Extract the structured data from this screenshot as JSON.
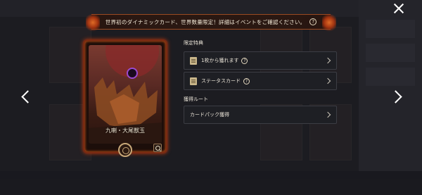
{
  "banner": {
    "text": "世界初のダイナミックカード、世界数量限定！詳細はイベントをご確認ください。",
    "help": "?"
  },
  "card": {
    "name": "九喇・大尾獣玉"
  },
  "limited_bonus": {
    "heading": "限定特典",
    "items": [
      {
        "label": "1枚から獲れます",
        "help": "?",
        "icon": "scroll-icon"
      },
      {
        "label": "ステータスカード",
        "help": "?",
        "icon": "scroll-icon"
      }
    ]
  },
  "acquisition": {
    "heading": "獲得ルート",
    "items": [
      {
        "label": "カードパック獲得"
      }
    ]
  },
  "icons": {
    "close": "close-icon",
    "prev": "chevron-left-icon",
    "next": "chevron-right-icon",
    "zoom": "zoom-icon"
  },
  "colors": {
    "accent_fire": "#b8380f",
    "panel_row": "#1e1f24",
    "moon": "#8a2a2a"
  }
}
